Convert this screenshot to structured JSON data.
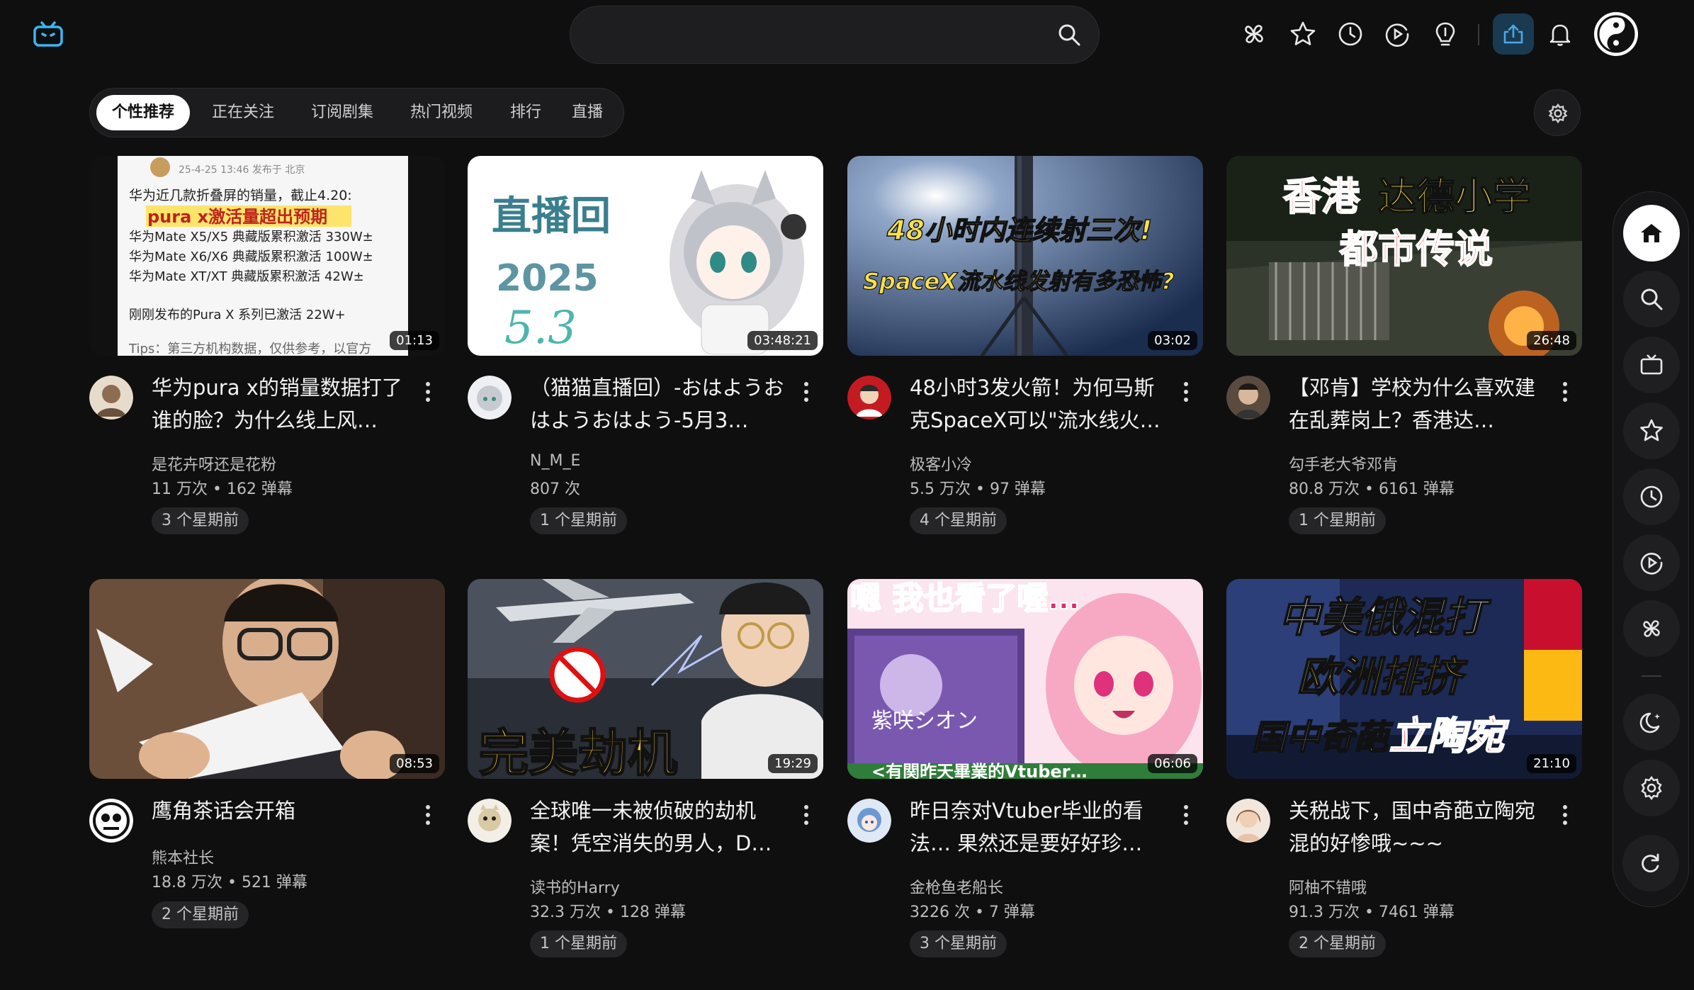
{
  "search": {
    "placeholder": ""
  },
  "tabs": [
    {
      "label": "个性推荐",
      "active": true
    },
    {
      "label": "正在关注",
      "active": false
    },
    {
      "label": "订阅剧集",
      "active": false
    },
    {
      "label": "热门视频",
      "active": false
    },
    {
      "label": "排行",
      "active": false
    },
    {
      "label": "直播",
      "active": false
    }
  ],
  "videos": [
    {
      "title": "华为pura x的销量数据打了谁的脸？为什么线上风…",
      "channel": "是花卉呀还是花粉",
      "stats": "11 万次 • 162 弹幕",
      "age": "3 个星期前",
      "duration": "01:13",
      "thumb_text": [
        "25-4-25 13:46 发布于 北京",
        "华为近几款折叠屏的销量，截止4.20:",
        "pura x激活量超出预期",
        "华为Mate X5/X5 典藏版累积激活 330W±",
        "华为Mate X6/X6 典藏版累积激活 100W±",
        "华为Mate XT/XT 典藏版累积激活 42W±",
        "刚刚发布的Pura X 系列已激活 22W+",
        "Tips：第三方机构数据，仅供参考，以官方"
      ]
    },
    {
      "title": "（猫猫直播回）-おはようおはようおはよう-5月3…",
      "channel": "N_M_E",
      "stats": "807 次",
      "age": "1 个星期前",
      "duration": "03:48:21",
      "thumb_text": [
        "直播回",
        "2025",
        "5.3"
      ]
    },
    {
      "title": "48小时3发火箭！为何马斯克SpaceX可以\"流水线火…",
      "channel": "极客小冷",
      "stats": "5.5 万次 • 97 弹幕",
      "age": "4 个星期前",
      "duration": "03:02",
      "thumb_text": [
        "48小时内连续射三次!",
        "SpaceX流水线发射有多恐怖?"
      ]
    },
    {
      "title": "【邓肯】学校为什么喜欢建在乱葬岗上？香港达…",
      "channel": "勾手老大爷邓肯",
      "stats": "80.8 万次 • 6161 弹幕",
      "age": "1 个星期前",
      "duration": "26:48",
      "thumb_text": [
        "香港 达德小学",
        "都市传说"
      ]
    },
    {
      "title": "鹰角茶话会开箱",
      "channel": "熊本社长",
      "stats": "18.8 万次 • 521 弹幕",
      "age": "2 个星期前",
      "duration": "08:53",
      "thumb_text": []
    },
    {
      "title": "全球唯一未被侦破的劫机案！凭空消失的男人，D…",
      "channel": "读书的Harry",
      "stats": "32.3 万次 • 128 弹幕",
      "age": "1 个星期前",
      "duration": "19:29",
      "thumb_text": [
        "完美劫机"
      ]
    },
    {
      "title": "昨日奈对Vtuber毕业的看法… 果然还是要好好珍…",
      "channel": "金枪鱼老船长",
      "stats": "3226 次 • 7 弹幕",
      "age": "3 个星期前",
      "duration": "06:06",
      "thumb_text": [
        "嗯 我也看了喔…",
        "紫咲シオン",
        "<有関昨天畢業的Vtuber…"
      ]
    },
    {
      "title": "关税战下，国中奇葩立陶宛混的好惨哦~~~",
      "channel": "阿柚不错哦",
      "stats": "91.3 万次 • 7461 弹幕",
      "age": "2 个星期前",
      "duration": "21:10",
      "thumb_text": [
        "中美俄混打",
        "欧洲排挤",
        "国中奇葩立陶宛"
      ]
    }
  ],
  "top_icons": [
    "app-logo-icon",
    "search-icon",
    "pinwheel-icon",
    "star-icon",
    "clock-icon",
    "replay-icon",
    "lightbulb-icon",
    "upload-icon",
    "bell-icon",
    "yin-yang-avatar"
  ],
  "sidebar_icons": [
    "home-icon",
    "search-icon",
    "tv-icon",
    "star-icon",
    "clock-icon",
    "replay-icon",
    "pinwheel-icon",
    "moon-icon",
    "settings-icon",
    "refresh-icon"
  ],
  "colors": {
    "accent": "#3ab6f0",
    "background": "#0f0f10",
    "upload_bg": "#1a3a52"
  }
}
